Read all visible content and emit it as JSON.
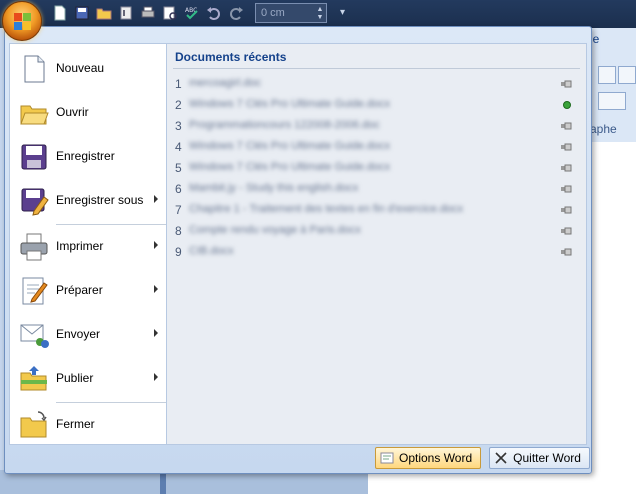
{
  "quick_access": {
    "zoom_value": "0 cm",
    "icons": [
      "new-doc-icon",
      "save-icon",
      "open-folder-icon",
      "attach-icon",
      "print-icon",
      "print-preview-icon",
      "spellcheck-icon",
      "undo-icon",
      "redo-icon"
    ]
  },
  "background": {
    "tab_label": "ie",
    "group_label": "aphe"
  },
  "menu": {
    "items": [
      {
        "label": "Nouveau",
        "icon": "new-document-icon",
        "submenu": false
      },
      {
        "label": "Ouvrir",
        "icon": "open-folder-icon",
        "submenu": false
      },
      {
        "label": "Enregistrer",
        "icon": "save-disk-icon",
        "submenu": false
      },
      {
        "label": "Enregistrer sous",
        "icon": "save-as-icon",
        "submenu": true
      },
      {
        "label": "Imprimer",
        "icon": "printer-icon",
        "submenu": true
      },
      {
        "label": "Préparer",
        "icon": "prepare-icon",
        "submenu": true
      },
      {
        "label": "Envoyer",
        "icon": "send-icon",
        "submenu": true
      },
      {
        "label": "Publier",
        "icon": "publish-icon",
        "submenu": true
      },
      {
        "label": "Fermer",
        "icon": "close-folder-icon",
        "submenu": false
      }
    ],
    "recent_title": "Documents récents",
    "recent": [
      {
        "num": "1",
        "name": "mercoagirl.doc",
        "pinned": false
      },
      {
        "num": "2",
        "name": "Windows 7 Clés Pro Ultimate Guide.docx",
        "pinned": true
      },
      {
        "num": "3",
        "name": "Programmationcours 122008-2006.doc",
        "pinned": false
      },
      {
        "num": "4",
        "name": "Windows 7 Clés Pro Ultimate Guide.docx",
        "pinned": false
      },
      {
        "num": "5",
        "name": "Windows 7 Clés Pro Ultimate Guide.docx",
        "pinned": false
      },
      {
        "num": "6",
        "name": "Mambit.jy - Study this english.docx",
        "pinned": false
      },
      {
        "num": "7",
        "name": "Chapitre 1 - Traitement des textes en fin d'exercice.docx",
        "pinned": false
      },
      {
        "num": "8",
        "name": "Compte rendu voyage à Paris.docx",
        "pinned": false
      },
      {
        "num": "9",
        "name": "CIB.docx",
        "pinned": false
      }
    ],
    "options_label": "Options Word",
    "quit_label": "Quitter Word"
  },
  "colors": {
    "accent": "#15428b",
    "pin_active": "#3aa33a"
  }
}
